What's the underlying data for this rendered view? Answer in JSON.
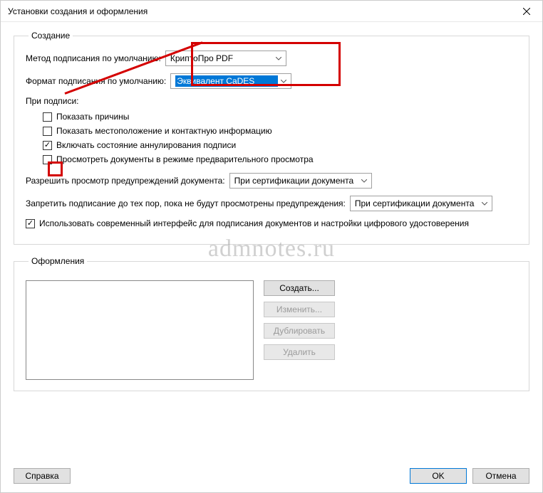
{
  "window": {
    "title": "Установки создания и оформления"
  },
  "creation": {
    "legend": "Создание",
    "method_label": "Метод подписания по умолчанию:",
    "method_value": "КриптоПро PDF",
    "format_label": "Формат подписания по умолчанию:",
    "format_value": "Эквивалент CaDES",
    "on_sign_label": "При подписи:",
    "cb_reasons": "Показать причины",
    "cb_location": "Показать местоположение и контактную информацию",
    "cb_revocation": "Включать состояние аннулирования подписи",
    "cb_preview": "Просмотреть документы в режиме предварительного просмотра",
    "allow_warn_label": "Разрешить просмотр предупреждений документа:",
    "allow_warn_value": "При сертификации документа",
    "prevent_sign_label": "Запретить подписание до тех пор, пока не будут просмотрены предупреждения:",
    "prevent_sign_value": "При сертификации документа",
    "cb_modern_ui": "Использовать современный интерфейс для подписания документов и настройки цифрового удостоверения"
  },
  "appearance": {
    "legend": "Оформления",
    "btn_create": "Создать...",
    "btn_edit": "Изменить...",
    "btn_duplicate": "Дублировать",
    "btn_delete": "Удалить"
  },
  "footer": {
    "help": "Справка",
    "ok": "OK",
    "cancel": "Отмена"
  },
  "watermark": "admnotes.ru"
}
